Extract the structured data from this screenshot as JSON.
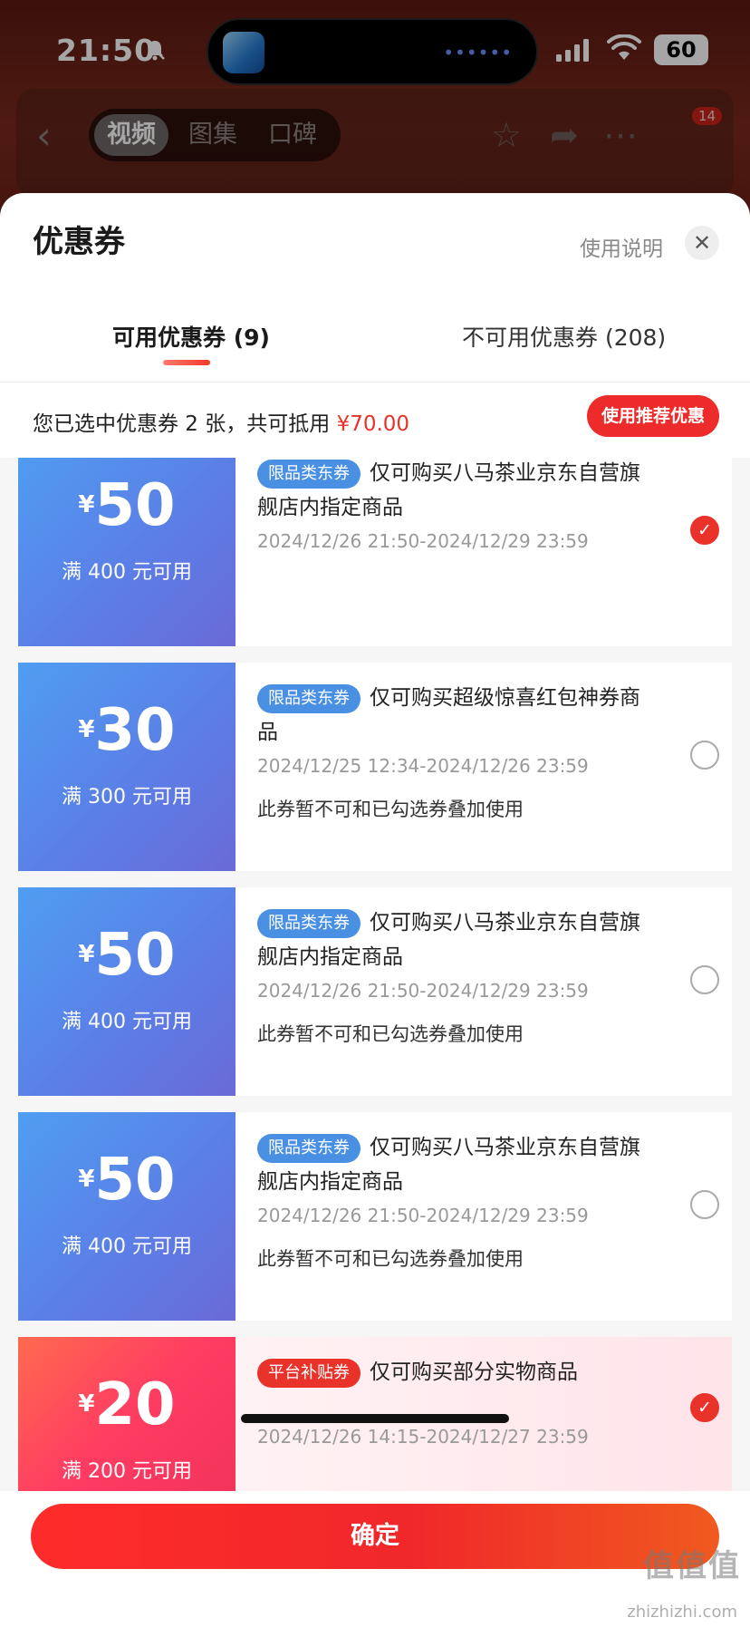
{
  "status_bar": {
    "time": "21:50",
    "battery": "60"
  },
  "nav": {
    "segments": [
      "视频",
      "图集",
      "口碑"
    ],
    "active_segment": "视频",
    "badge": "14"
  },
  "sheet": {
    "title": "优惠券",
    "help_label": "使用说明",
    "close_icon": "close-icon"
  },
  "tabs": [
    {
      "label": "可用优惠券 (9)",
      "active": true
    },
    {
      "label": "不可用优惠券 (208)",
      "active": false
    }
  ],
  "summary": {
    "text": "您已选中优惠券 2 张，共可抵用",
    "amount": "¥70.00",
    "recommend_label": "使用推荐优惠"
  },
  "coupons": [
    {
      "yen": "¥",
      "amount": "50",
      "condition": "满 400 元可用",
      "tag": "限品类东券",
      "title": "仅可购买八马茶业京东自营旗舰店内指定商品",
      "date": "2024/12/26 21:50-2024/12/29 23:59",
      "note": "",
      "checked": true
    },
    {
      "yen": "¥",
      "amount": "30",
      "condition": "满 300 元可用",
      "tag": "限品类东券",
      "title": "仅可购买超级惊喜红包神券商品",
      "date": "2024/12/25 12:34-2024/12/26 23:59",
      "note": "此券暂不可和已勾选券叠加使用",
      "checked": false
    },
    {
      "yen": "¥",
      "amount": "50",
      "condition": "满 400 元可用",
      "tag": "限品类东券",
      "title": "仅可购买八马茶业京东自营旗舰店内指定商品",
      "date": "2024/12/26 21:50-2024/12/29 23:59",
      "note": "此券暂不可和已勾选券叠加使用",
      "checked": false
    },
    {
      "yen": "¥",
      "amount": "50",
      "condition": "满 400 元可用",
      "tag": "限品类东券",
      "title": "仅可购买八马茶业京东自营旗舰店内指定商品",
      "date": "2024/12/26 21:50-2024/12/29 23:59",
      "note": "此券暂不可和已勾选券叠加使用",
      "checked": false
    },
    {
      "yen": "¥",
      "amount": "20",
      "condition": "满 200 元可用",
      "tag": "平台补贴券",
      "title": "仅可购买部分实物商品",
      "date": "2024/12/26 14:15-2024/12/27 23:59",
      "note": "",
      "checked": true
    }
  ],
  "footer": {
    "confirm_label": "确定"
  },
  "watermark": {
    "logo": "值值值",
    "url": "zhizhizhi.com"
  },
  "colors": {
    "accent": "#e8322a",
    "coupon_blue": "#5b7fe6",
    "tag_blue": "#4a90e2"
  }
}
